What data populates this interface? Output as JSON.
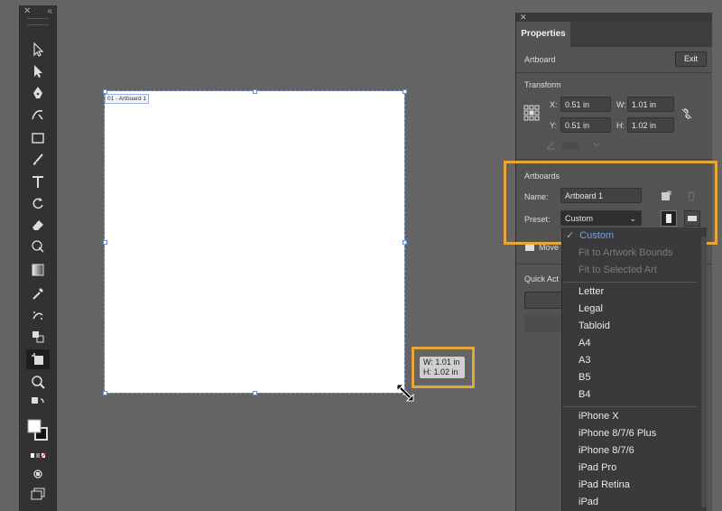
{
  "toolbar": {
    "close_glyph": "✕",
    "collapse_glyph": "«"
  },
  "artboard": {
    "label": "01 - Artboard 1"
  },
  "dimensions_tooltip": {
    "w": "W: 1.01 in",
    "h": "H: 1.02 in"
  },
  "panel": {
    "close_glyph": "✕",
    "tab": "Properties",
    "section_artboard": "Artboard",
    "exit_label": "Exit",
    "transform_title": "Transform",
    "x_label": "X:",
    "x_value": "0.51 in",
    "y_label": "Y:",
    "y_value": "0.51 in",
    "w_label": "W:",
    "w_value": "1.01 in",
    "h_label": "H:",
    "h_value": "1.02 in",
    "artboards_title": "Artboards",
    "name_label": "Name:",
    "name_value": "Artboard 1",
    "preset_label": "Preset:",
    "preset_value": "Custom",
    "move_label": "Move",
    "quick_actions_label": "Quick Act"
  },
  "preset_menu": {
    "selected": "Custom",
    "disabled": [
      "Fit to Artwork Bounds",
      "Fit to Selected Art"
    ],
    "paper": [
      "Letter",
      "Legal",
      "Tabloid",
      "A4",
      "A3",
      "B5",
      "B4"
    ],
    "devices": [
      "iPhone X",
      "iPhone 8/7/6 Plus",
      "iPhone 8/7/6",
      "iPad Pro",
      "iPad Retina",
      "iPad"
    ]
  },
  "colors": {
    "accent_highlight": "#e8a63a",
    "selection_blue": "#6aa4f0",
    "canvas_bg": "#646464"
  }
}
